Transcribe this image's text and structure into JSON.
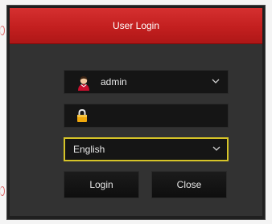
{
  "dialog": {
    "title": "User Login",
    "username": {
      "value": "admin",
      "icon": "user-icon"
    },
    "password": {
      "value": "",
      "icon": "lock-icon"
    },
    "language": {
      "value": "English"
    },
    "buttons": {
      "login": "Login",
      "close": "Close"
    }
  },
  "colors": {
    "titlebar": "#c82020",
    "panel": "#323232",
    "field": "#151515",
    "focus_border": "#d6c428"
  }
}
